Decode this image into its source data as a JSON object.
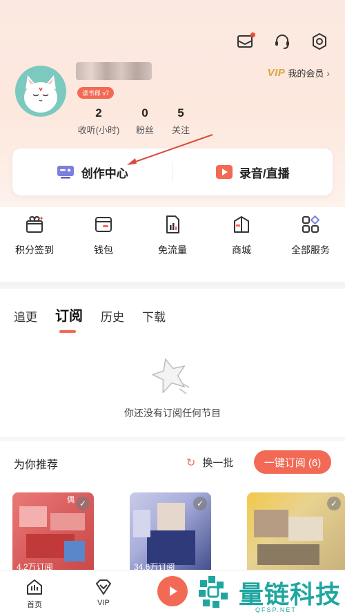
{
  "header": {
    "icons": [
      "mail-icon",
      "headset-icon",
      "settings-icon"
    ],
    "level_badge": "读书郎 v7",
    "vip_label": "VIP",
    "vip_link": "我的会员",
    "stats": [
      {
        "value": "2",
        "label": "收听(小时)"
      },
      {
        "value": "0",
        "label": "粉丝"
      },
      {
        "value": "5",
        "label": "关注"
      }
    ]
  },
  "actions": {
    "creator_center": "创作中心",
    "record_live": "录音/直播"
  },
  "services": [
    {
      "label": "积分签到",
      "icon": "gift-sign-icon"
    },
    {
      "label": "钱包",
      "icon": "wallet-icon"
    },
    {
      "label": "免流量",
      "icon": "data-sim-icon"
    },
    {
      "label": "商城",
      "icon": "shop-icon"
    },
    {
      "label": "全部服务",
      "icon": "all-services-icon"
    }
  ],
  "tabs": [
    {
      "label": "追更",
      "active": false
    },
    {
      "label": "订阅",
      "active": true
    },
    {
      "label": "历史",
      "active": false
    },
    {
      "label": "下载",
      "active": false
    }
  ],
  "empty_state": {
    "message": "你还没有订阅任何节目"
  },
  "recommend": {
    "title": "为你推荐",
    "refresh": "换一批",
    "subscribe_all": "一键订阅 (6)",
    "cards": [
      {
        "count": "4.2万订阅",
        "tag": "偶"
      },
      {
        "count": "34.6万订阅",
        "tag": ""
      },
      {
        "count": "",
        "tag": ""
      }
    ]
  },
  "bottom_nav": {
    "home": "首页",
    "vip": "VIP"
  },
  "watermark": {
    "main": "量链科技",
    "sub": "QFSP.NET"
  },
  "colors": {
    "accent": "#f26a55",
    "vip_gold": "#d9a441",
    "watermark": "#1fa6a0"
  }
}
